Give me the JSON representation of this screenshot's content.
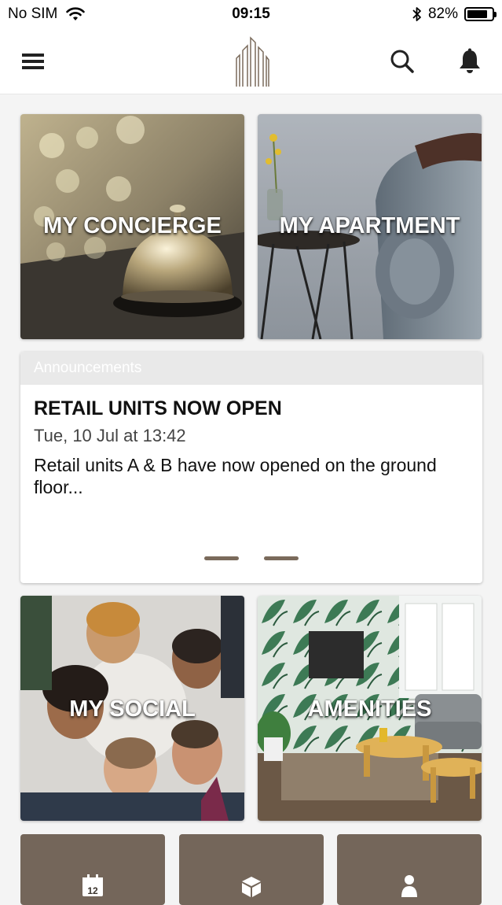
{
  "status_bar": {
    "carrier": "No SIM",
    "time": "09:15",
    "battery_percent": "82%",
    "battery_level": 0.82
  },
  "nav": {
    "menu_icon": "hamburger-icon",
    "logo_icon": "building-logo-icon",
    "search_icon": "search-icon",
    "notifications_icon": "bell-icon"
  },
  "tiles": {
    "concierge": "MY CONCIERGE",
    "apartment": "MY APARTMENT",
    "social": "MY SOCIAL",
    "amenities": "AMENITIES"
  },
  "announcements": {
    "header": "Announcements",
    "title": "RETAIL UNITS NOW OPEN",
    "date": "Tue, 10 Jul at 13:42",
    "body": "Retail units A & B have now opened on the ground floor...",
    "pages": 2
  },
  "bottom_buttons": [
    {
      "icon": "calendar-icon",
      "calendar_day": "12"
    },
    {
      "icon": "parcel-icon"
    },
    {
      "icon": "person-icon"
    }
  ],
  "colors": {
    "accent": "#74665a",
    "pager": "#7a6a5b"
  }
}
